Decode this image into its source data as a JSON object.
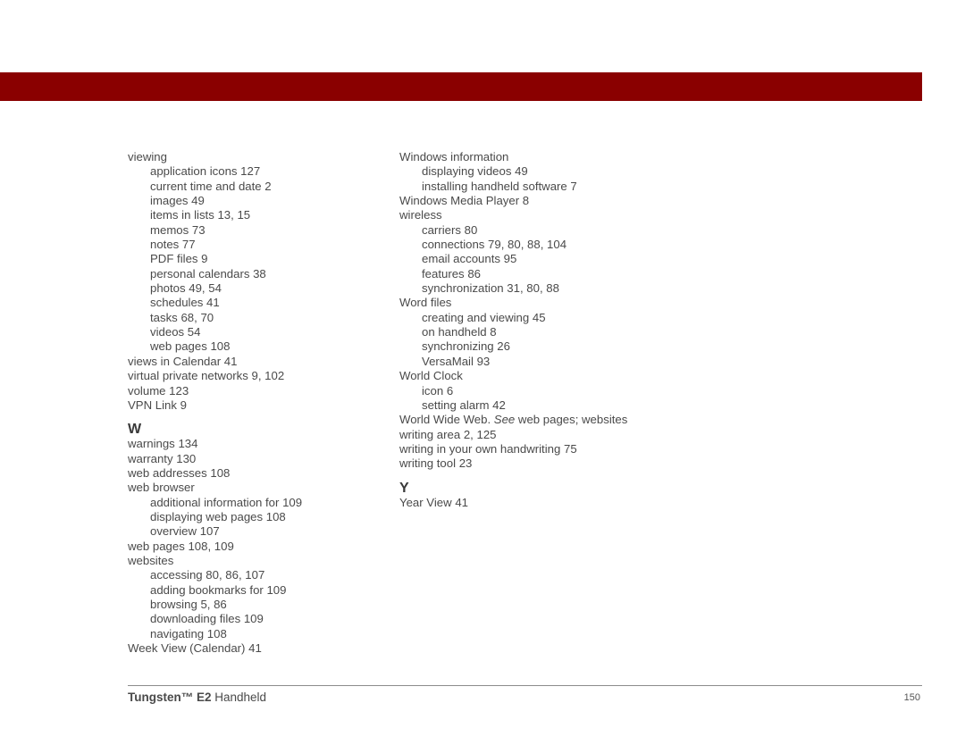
{
  "colors": {
    "header_bar": "#8a0000",
    "text": "#4a4a4a"
  },
  "left_column": [
    {
      "text": "viewing",
      "level": 0
    },
    {
      "text": "application icons 127",
      "level": 1
    },
    {
      "text": "current time and date 2",
      "level": 1
    },
    {
      "text": "images 49",
      "level": 1
    },
    {
      "text": "items in lists 13, 15",
      "level": 1
    },
    {
      "text": "memos 73",
      "level": 1
    },
    {
      "text": "notes 77",
      "level": 1
    },
    {
      "text": "PDF files 9",
      "level": 1
    },
    {
      "text": "personal calendars 38",
      "level": 1
    },
    {
      "text": "photos 49, 54",
      "level": 1
    },
    {
      "text": "schedules 41",
      "level": 1
    },
    {
      "text": "tasks 68, 70",
      "level": 1
    },
    {
      "text": "videos 54",
      "level": 1
    },
    {
      "text": "web pages 108",
      "level": 1
    },
    {
      "text": "views in Calendar 41",
      "level": 0
    },
    {
      "text": "virtual private networks 9, 102",
      "level": 0
    },
    {
      "text": "volume 123",
      "level": 0
    },
    {
      "text": "VPN Link 9",
      "level": 0
    },
    {
      "letter": "W"
    },
    {
      "text": "warnings 134",
      "level": 0
    },
    {
      "text": "warranty 130",
      "level": 0
    },
    {
      "text": "web addresses 108",
      "level": 0
    },
    {
      "text": "web browser",
      "level": 0
    },
    {
      "text": "additional information for 109",
      "level": 1
    },
    {
      "text": "displaying web pages 108",
      "level": 1
    },
    {
      "text": "overview 107",
      "level": 1
    },
    {
      "text": "web pages 108, 109",
      "level": 0
    },
    {
      "text": "websites",
      "level": 0
    },
    {
      "text": "accessing 80, 86, 107",
      "level": 1
    },
    {
      "text": "adding bookmarks for 109",
      "level": 1
    },
    {
      "text": "browsing 5, 86",
      "level": 1
    },
    {
      "text": "downloading files 109",
      "level": 1
    },
    {
      "text": "navigating 108",
      "level": 1
    },
    {
      "text": "Week View (Calendar) 41",
      "level": 0
    }
  ],
  "right_column": [
    {
      "text": "Windows information",
      "level": 0
    },
    {
      "text": "displaying videos 49",
      "level": 1
    },
    {
      "text": "installing handheld software 7",
      "level": 1
    },
    {
      "text": "Windows Media Player 8",
      "level": 0
    },
    {
      "text": "wireless",
      "level": 0
    },
    {
      "text": "carriers 80",
      "level": 1
    },
    {
      "text": "connections 79, 80, 88, 104",
      "level": 1
    },
    {
      "text": "email accounts 95",
      "level": 1
    },
    {
      "text": "features 86",
      "level": 1
    },
    {
      "text": "synchronization 31, 80, 88",
      "level": 1
    },
    {
      "text": "Word files",
      "level": 0
    },
    {
      "text": "creating and viewing 45",
      "level": 1
    },
    {
      "text": "on handheld 8",
      "level": 1
    },
    {
      "text": "synchronizing 26",
      "level": 1
    },
    {
      "text": "VersaMail 93",
      "level": 1
    },
    {
      "text": "World Clock",
      "level": 0
    },
    {
      "text": "icon 6",
      "level": 1
    },
    {
      "text": "setting alarm 42",
      "level": 1
    },
    {
      "text": "World Wide Web. ",
      "see": "See",
      "after": " web pages; websites",
      "level": 0
    },
    {
      "text": "writing area 2, 125",
      "level": 0
    },
    {
      "text": "writing in your own handwriting 75",
      "level": 0
    },
    {
      "text": "writing tool 23",
      "level": 0
    },
    {
      "letter": "Y"
    },
    {
      "text": "Year View 41",
      "level": 0
    }
  ],
  "footer": {
    "product_bold": "Tungsten™ E2",
    "product_rest": " Handheld",
    "page_number": "150"
  }
}
